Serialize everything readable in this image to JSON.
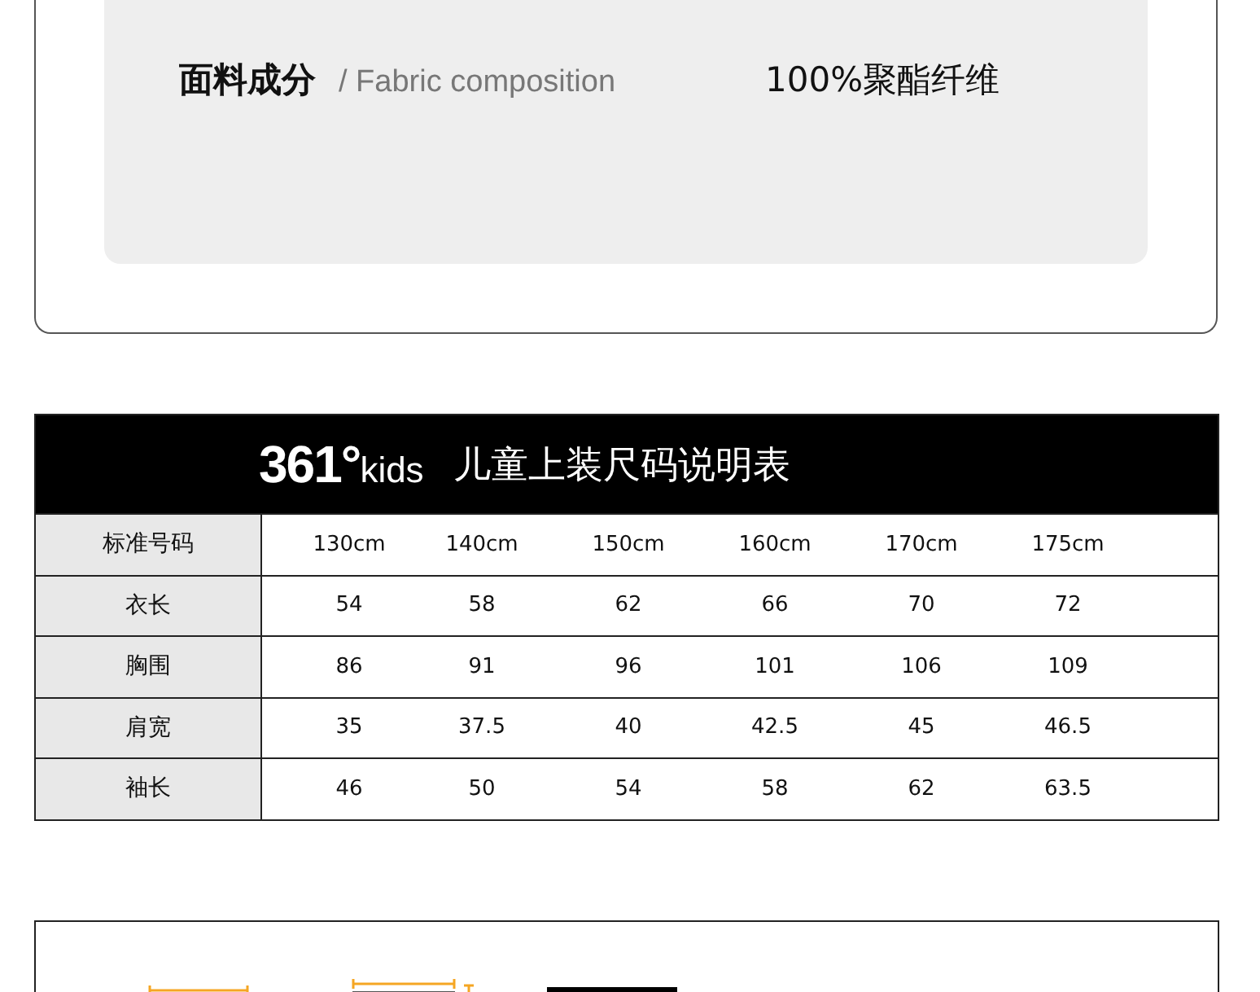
{
  "specs": [
    {
      "label": "面料成分",
      "label_en": "/ Fabric composition",
      "value": "100%聚酯纤维"
    }
  ],
  "size_chart": {
    "logo": {
      "number": "361°",
      "word": "kids"
    },
    "title": "儿童上装尺码说明表",
    "columns": [
      "标准号码",
      "130cm",
      "140cm",
      "150cm",
      "160cm",
      "170cm",
      "175cm"
    ],
    "rows": [
      [
        "衣长",
        "54",
        "58",
        "62",
        "66",
        "70",
        "72"
      ],
      [
        "胸围",
        "86",
        "91",
        "96",
        "101",
        "106",
        "109"
      ],
      [
        "肩宽",
        "35",
        "37.5",
        "40",
        "42.5",
        "45",
        "46.5"
      ],
      [
        "袖长",
        "46",
        "50",
        "54",
        "58",
        "62",
        "63.5"
      ]
    ]
  }
}
